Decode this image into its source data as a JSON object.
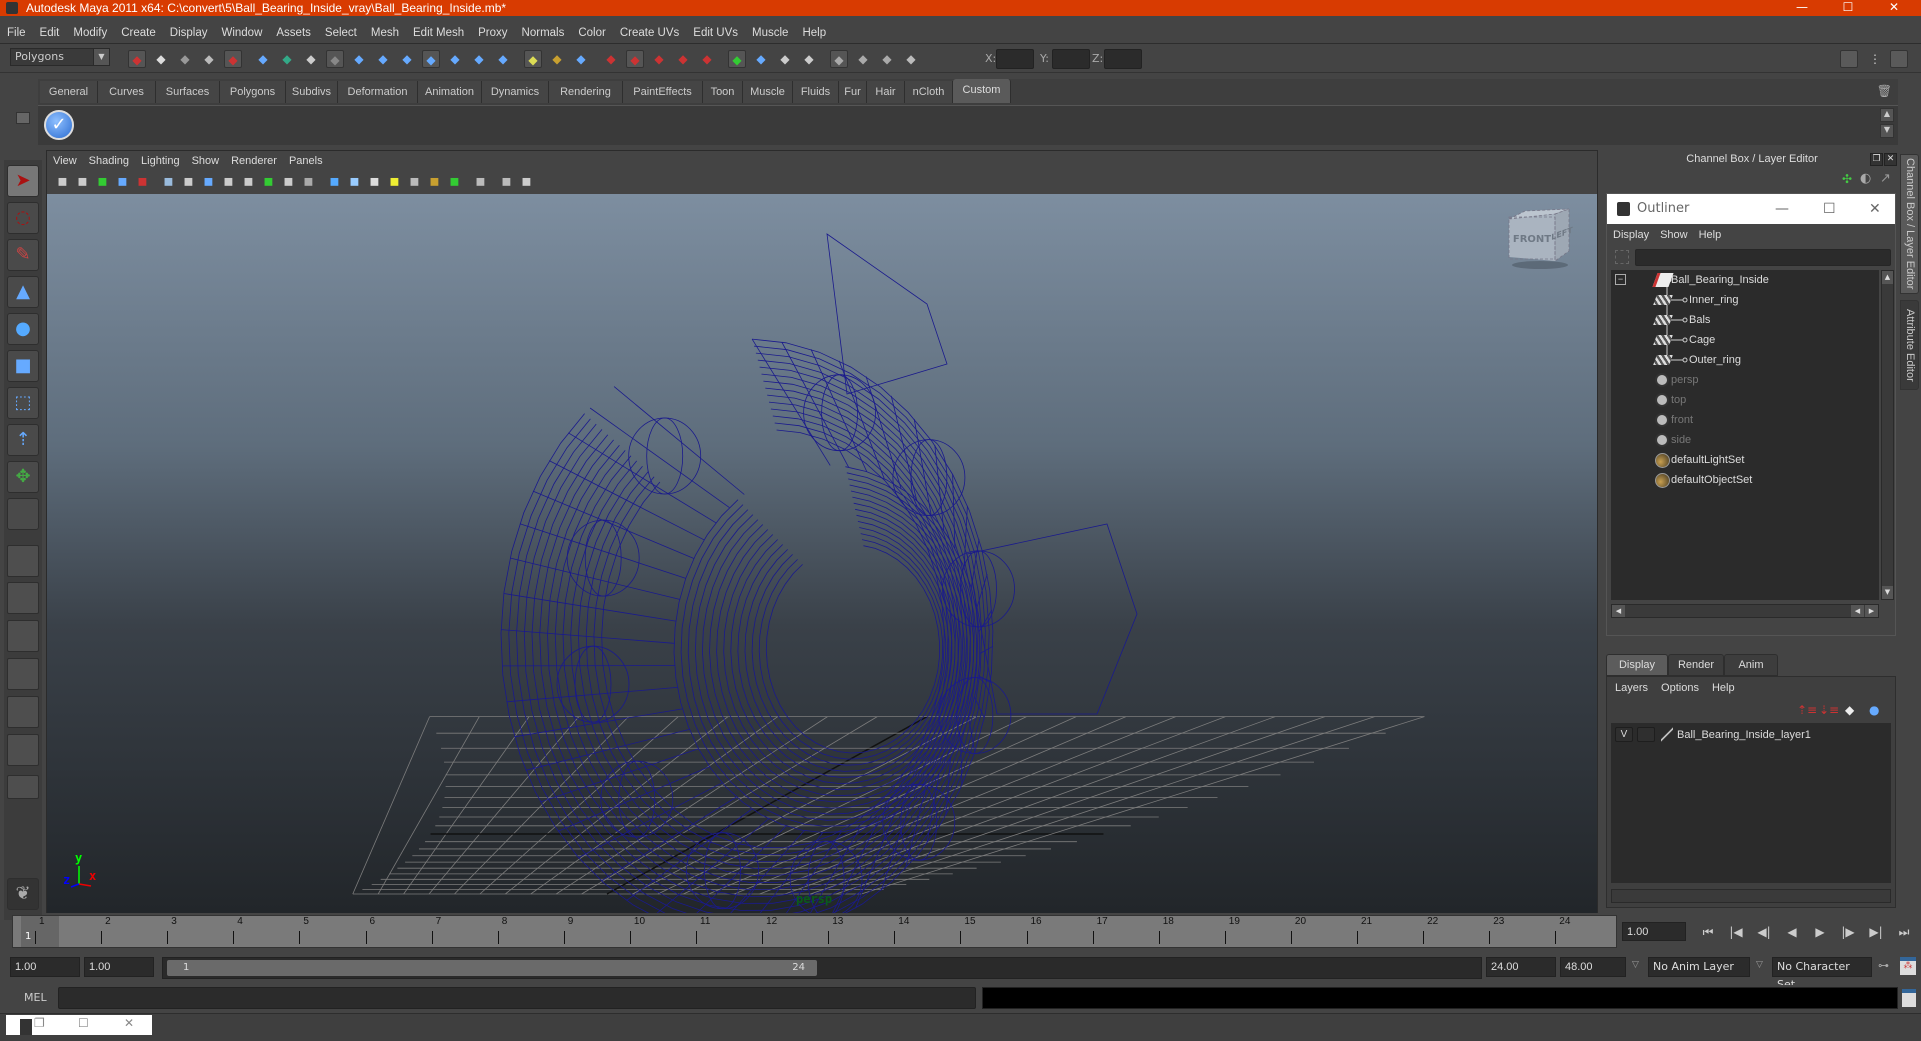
{
  "window": {
    "title": "Autodesk Maya 2011 x64: C:\\convert\\5\\Ball_Bearing_Inside_vray\\Ball_Bearing_Inside.mb*",
    "controls": [
      "minimize",
      "maximize",
      "close"
    ],
    "accent_color": "#d83b01"
  },
  "menubar": [
    "File",
    "Edit",
    "Modify",
    "Create",
    "Display",
    "Window",
    "Assets",
    "Select",
    "Mesh",
    "Edit Mesh",
    "Proxy",
    "Normals",
    "Color",
    "Create UVs",
    "Edit UVs",
    "Muscle",
    "Help"
  ],
  "statusline": {
    "mode": "Polygons",
    "xyz_labels": [
      "X:",
      "Y:",
      "Z:"
    ],
    "xyz_values": [
      "",
      "",
      ""
    ]
  },
  "shelf": {
    "tabs": [
      "General",
      "Curves",
      "Surfaces",
      "Polygons",
      "Subdivs",
      "Deformation",
      "Animation",
      "Dynamics",
      "Rendering",
      "PaintEffects",
      "Toon",
      "Muscle",
      "Fluids",
      "Fur",
      "Hair",
      "nCloth",
      "Custom"
    ],
    "active_tab": "Custom",
    "items": [
      {
        "icon": "checkmark-icon",
        "glyph": "✓"
      }
    ]
  },
  "toolbox": {
    "tools": [
      {
        "name": "select-tool",
        "glyph": "➤"
      },
      {
        "name": "lasso-tool",
        "glyph": "◌"
      },
      {
        "name": "paint-select-tool",
        "glyph": "✎"
      },
      {
        "name": "move-tool",
        "glyph": "▲"
      },
      {
        "name": "rotate-tool",
        "glyph": "●"
      },
      {
        "name": "scale-tool",
        "glyph": "■"
      },
      {
        "name": "universal-manipulator",
        "glyph": "⬚"
      },
      {
        "name": "soft-modification-tool",
        "glyph": "⇡"
      },
      {
        "name": "show-manipulator-tool",
        "glyph": "✥"
      },
      {
        "name": "last-tool",
        "glyph": ""
      }
    ],
    "active_tool": "select-tool"
  },
  "viewport": {
    "menu": [
      "View",
      "Shading",
      "Lighting",
      "Show",
      "Renderer",
      "Panels"
    ],
    "camera": "persp",
    "viewcube": {
      "front": "FRONT",
      "side": "LEFT"
    },
    "axis": {
      "x": "x",
      "y": "y",
      "z": "z"
    },
    "wire_color": "#1a1a8c"
  },
  "channel_box": {
    "title": "Channel Box / Layer Editor"
  },
  "side_tabs": [
    "Channel Box / Layer Editor",
    "Attribute Editor"
  ],
  "outliner": {
    "title": "Outliner",
    "menu": [
      "Display",
      "Show",
      "Help"
    ],
    "filter": "",
    "items": [
      {
        "name": "Ball_Bearing_Inside",
        "type": "transform",
        "level": 0,
        "expanded": true,
        "dim": false
      },
      {
        "name": "Inner_ring",
        "type": "mesh",
        "level": 1,
        "dim": false
      },
      {
        "name": "Bals",
        "type": "mesh",
        "level": 1,
        "dim": false
      },
      {
        "name": "Cage",
        "type": "mesh",
        "level": 1,
        "dim": false
      },
      {
        "name": "Outer_ring",
        "type": "mesh",
        "level": 1,
        "dim": false
      },
      {
        "name": "persp",
        "type": "camera",
        "level": 0,
        "dim": true
      },
      {
        "name": "top",
        "type": "camera",
        "level": 0,
        "dim": true
      },
      {
        "name": "front",
        "type": "camera",
        "level": 0,
        "dim": true
      },
      {
        "name": "side",
        "type": "camera",
        "level": 0,
        "dim": true
      },
      {
        "name": "defaultLightSet",
        "type": "set",
        "level": 0,
        "dim": false
      },
      {
        "name": "defaultObjectSet",
        "type": "set",
        "level": 0,
        "dim": false
      }
    ]
  },
  "layer_editor": {
    "tabs": [
      "Display",
      "Render",
      "Anim"
    ],
    "active_tab": "Display",
    "menu": [
      "Layers",
      "Options",
      "Help"
    ],
    "layers": [
      {
        "visible": "V",
        "playback": "",
        "name": "Ball_Bearing_Inside_layer1"
      }
    ]
  },
  "timeline": {
    "ticks": [
      "1",
      "2",
      "3",
      "4",
      "5",
      "6",
      "7",
      "8",
      "9",
      "10",
      "11",
      "12",
      "13",
      "14",
      "15",
      "16",
      "17",
      "18",
      "19",
      "20",
      "21",
      "22",
      "23",
      "24"
    ],
    "current_frame_label": "1",
    "current_time": "1.00",
    "playback_buttons": [
      "go-to-start",
      "step-back-key",
      "step-back-frame",
      "play-backward",
      "play-forward",
      "step-forward-frame",
      "step-forward-key",
      "go-to-end"
    ]
  },
  "range": {
    "start_time": "1.00",
    "playback_start": "1.00",
    "slider_start": "1",
    "slider_end": "24",
    "playback_end": "24.00",
    "end_time": "48.00",
    "anim_layer": "No Anim Layer",
    "character_set": "No Character Set"
  },
  "command_line": {
    "label": "MEL",
    "input": "",
    "result": ""
  }
}
